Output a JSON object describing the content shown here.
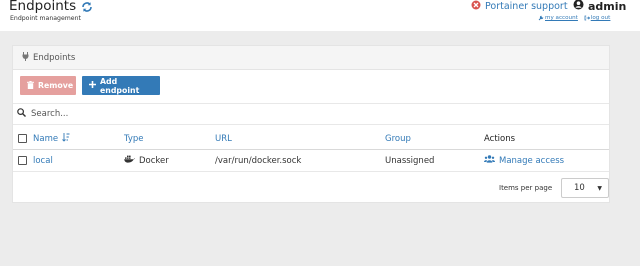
{
  "header": {
    "title": "Endpoints",
    "subtitle": "Endpoint management",
    "support_label": "Portainer support",
    "username": "admin",
    "my_account_label": "my account",
    "logout_label": "log out"
  },
  "panel": {
    "heading": "Endpoints",
    "remove_label": "Remove",
    "add_label": "Add endpoint",
    "search_placeholder": "Search...",
    "columns": {
      "name": "Name",
      "type": "Type",
      "url": "URL",
      "group": "Group",
      "actions": "Actions"
    },
    "rows": [
      {
        "name": "local",
        "type": "Docker",
        "url": "/var/run/docker.sock",
        "group": "Unassigned",
        "action": "Manage access"
      }
    ],
    "pagination": {
      "items_per_page_label": "Items per page",
      "items_per_page_value": "10"
    }
  },
  "colors": {
    "link": "#337ab7",
    "danger_disabled": "#e5a09e",
    "support_icon": "#d9534f"
  },
  "icons": [
    "refresh-icon",
    "support-icon",
    "user-icon",
    "wrench-icon",
    "logout-icon",
    "plug-icon",
    "trash-icon",
    "plus-icon",
    "search-icon",
    "sort-icon",
    "docker-icon",
    "users-icon",
    "caret-down-icon"
  ]
}
